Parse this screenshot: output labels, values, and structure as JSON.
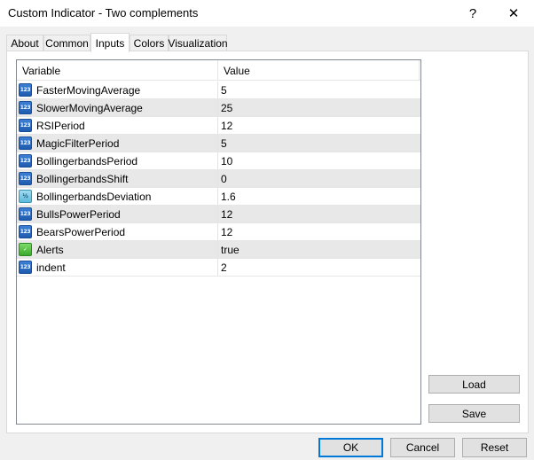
{
  "window": {
    "title": "Custom Indicator - Two complements",
    "help_glyph": "?",
    "close_glyph": "✕"
  },
  "tabs": [
    {
      "label": "About"
    },
    {
      "label": "Common"
    },
    {
      "label": "Inputs",
      "active": true
    },
    {
      "label": "Colors"
    },
    {
      "label": "Visualization"
    }
  ],
  "grid": {
    "headers": {
      "variable": "Variable",
      "value": "Value"
    },
    "rows": [
      {
        "icon": "int-type-icon",
        "icon_text": "123",
        "variable": "FasterMovingAverage",
        "value": "5"
      },
      {
        "icon": "int-type-icon",
        "icon_text": "123",
        "variable": "SlowerMovingAverage",
        "value": "25"
      },
      {
        "icon": "int-type-icon",
        "icon_text": "123",
        "variable": "RSIPeriod",
        "value": "12"
      },
      {
        "icon": "int-type-icon",
        "icon_text": "123",
        "variable": "MagicFilterPeriod",
        "value": "5"
      },
      {
        "icon": "int-type-icon",
        "icon_text": "123",
        "variable": "BollingerbandsPeriod",
        "value": "10"
      },
      {
        "icon": "int-type-icon",
        "icon_text": "123",
        "variable": "BollingerbandsShift",
        "value": "0"
      },
      {
        "icon": "double-type-icon",
        "icon_text": "½",
        "variable": "BollingerbandsDeviation",
        "value": "1.6"
      },
      {
        "icon": "int-type-icon",
        "icon_text": "123",
        "variable": "BullsPowerPeriod",
        "value": "12"
      },
      {
        "icon": "int-type-icon",
        "icon_text": "123",
        "variable": "BearsPowerPeriod",
        "value": "12"
      },
      {
        "icon": "bool-type-icon",
        "icon_text": "✓",
        "variable": "Alerts",
        "value": "true"
      },
      {
        "icon": "int-type-icon",
        "icon_text": "123",
        "variable": "indent",
        "value": "2"
      }
    ]
  },
  "buttons": {
    "load": "Load",
    "save": "Save",
    "ok": "OK",
    "cancel": "Cancel",
    "reset": "Reset"
  }
}
